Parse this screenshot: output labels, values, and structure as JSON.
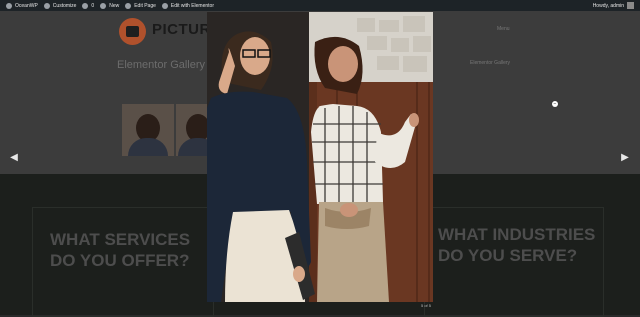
{
  "admin_bar": {
    "items": [
      {
        "label": "OceanWP",
        "icon": "home-icon"
      },
      {
        "label": "Customize",
        "icon": "brush-icon"
      },
      {
        "label": "0",
        "icon": "comment-icon"
      },
      {
        "label": "New",
        "icon": "plus-icon"
      },
      {
        "label": "Edit Page",
        "icon": "pencil-icon"
      },
      {
        "label": "Edit with Elementor",
        "icon": "elementor-icon"
      }
    ],
    "greeting": "Howdy, admin"
  },
  "site": {
    "brand": "PICTURE",
    "menu_link": "Menu",
    "page_title": "Elementor Gallery",
    "breadcrumb": "Elementor Gallery"
  },
  "sections": {
    "left_heading": "WHAT SERVICES DO YOU OFFER?",
    "right_heading": "WHAT INDUSTRIES DO YOU SERVE?"
  },
  "lightbox": {
    "counter": "5 of 5",
    "prev_icon": "chevron-left-icon",
    "next_icon": "chevron-right-icon",
    "zoom_icon": "zoom-icon",
    "prev_glyph": "◀",
    "next_glyph": "▶",
    "zoom_glyph": "−"
  },
  "colors": {
    "admin_bar": "#1d2327",
    "overlay_bg": "#3c3c3c",
    "bottom_bg": "#1c1f1c"
  }
}
